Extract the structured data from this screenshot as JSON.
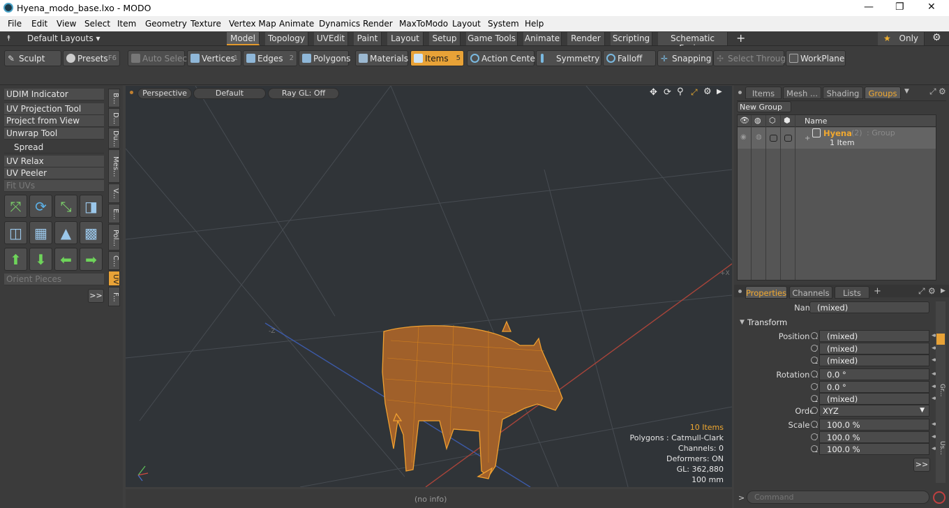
{
  "window": {
    "title": "Hyena_modo_base.lxo - MODO",
    "minimize": "—",
    "maximize": "❐",
    "close": "✕"
  },
  "menu": [
    "File",
    "Edit",
    "View",
    "Select",
    "Item",
    "Geometry",
    "Texture",
    "Vertex Map",
    "Animate",
    "Dynamics",
    "Render",
    "MaxToModo",
    "Layout",
    "System",
    "Help"
  ],
  "layoutbar": {
    "layouts_label": "Default Layouts ▾",
    "tabs": [
      "Model",
      "Topology",
      "UVEdit",
      "Paint",
      "Layout",
      "Setup",
      "Game Tools",
      "Animate",
      "Render",
      "Scripting",
      "Schematic Fusion"
    ],
    "active_tab": "Model",
    "plus": "+",
    "only_label": "Only",
    "star": "★"
  },
  "toolbar": {
    "sculpt": "Sculpt",
    "presets": "Presets",
    "presets_key": "F6",
    "auto_select": "Auto Select",
    "vertices": "Vertices",
    "vertices_num": "1",
    "edges": "Edges",
    "edges_num": "2",
    "polygons": "Polygons",
    "materials": "Materials",
    "items": "Items",
    "items_num": "5",
    "action_center": "Action Center",
    "symmetry": "Symmetry",
    "falloff": "Falloff",
    "snapping": "Snapping",
    "select_through": "Select Through",
    "workplane": "WorkPlane"
  },
  "left_panel": {
    "items": [
      "UDIM Indicator",
      "UV Projection Tool",
      "Project from View",
      "Unwrap Tool",
      "Spread",
      "UV Relax",
      "UV Peeler",
      "Fit UVs"
    ],
    "orient_pieces": "Orient Pieces",
    "more": ">>",
    "vtabs": [
      "B...",
      "D...",
      "Du...",
      "Mes...",
      "V...",
      "E...",
      "Pol...",
      "C...",
      "UV",
      "F..."
    ],
    "active_vtab": "UV"
  },
  "viewport": {
    "perspective": "Perspective",
    "default": "Default",
    "raygl": "Ray GL: Off",
    "axis_z": "-Z",
    "axis_x": "+X",
    "stats": {
      "items": "10 Items",
      "polygons": "Polygons : Catmull-Clark",
      "channels": "Channels: 0",
      "deformers": "Deformers: ON",
      "gl": "GL: 362,880",
      "scale": "100 mm"
    },
    "status": "(no info)"
  },
  "right_panel": {
    "tabs_top": [
      "Items",
      "Mesh ...",
      "Shading",
      "Groups"
    ],
    "active_top": "Groups",
    "new_group": "New Group",
    "col_name": "Name",
    "group": {
      "name": "Hyena",
      "count": "(2)",
      "type": ": Group",
      "sub": "1 Item"
    },
    "tabs_bottom": [
      "Properties",
      "Channels",
      "Lists"
    ],
    "active_bottom": "Properties",
    "props": {
      "name_label": "Name",
      "name_value": "(mixed)",
      "transform": "Transform",
      "pos_label": "Position X",
      "y": "Y",
      "z": "Z",
      "pos_x": "(mixed)",
      "pos_y": "(mixed)",
      "pos_z": "(mixed)",
      "rot_label": "Rotation X",
      "rot_x": "0.0 °",
      "rot_y": "0.0 °",
      "rot_z": "(mixed)",
      "order_label": "Order",
      "order_value": "XYZ",
      "scale_label": "Scale X",
      "scale_x": "100.0 %",
      "scale_y": "100.0 %",
      "scale_z": "100.0 %",
      "more": ">>"
    },
    "side_tabs": [
      "Gr...",
      "Us..."
    ],
    "command_placeholder": "Command"
  },
  "colors": {
    "accent": "#e8a237",
    "wire": "#f0a030"
  }
}
